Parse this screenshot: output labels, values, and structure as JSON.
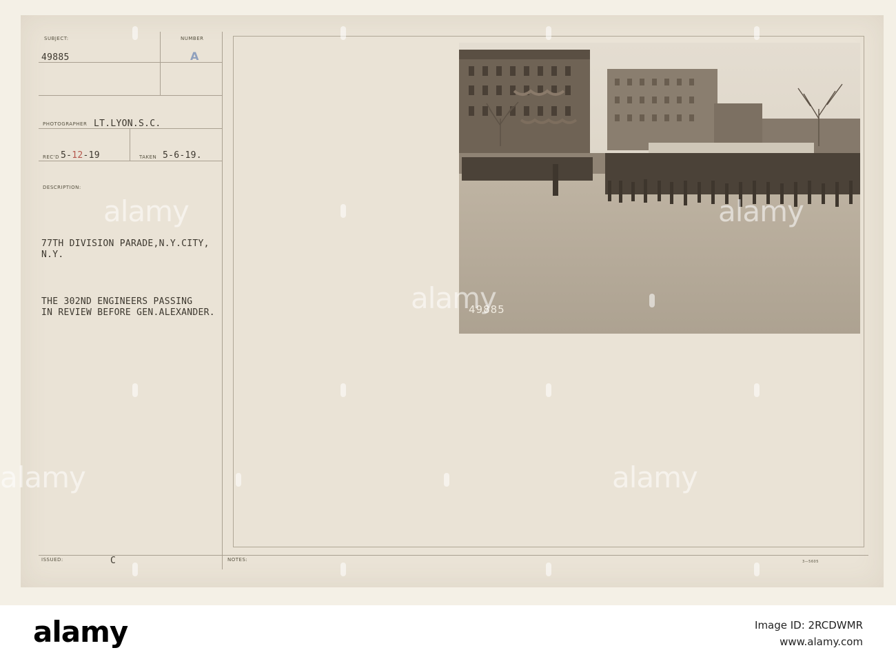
{
  "card": {
    "subject_label": "SUBJECT:",
    "subject_value": "49885",
    "number_label": "NUMBER",
    "number_value": "A",
    "photographer_label": "PHOTOGRAPHER",
    "photographer_value": "LT.LYON.S.C.",
    "recd_label": "REC'D",
    "recd_value_prefix": "5-",
    "recd_value_red": "12",
    "recd_value_suffix": "-19",
    "taken_label": "TAKEN",
    "taken_value": "5-6-19.",
    "description_label": "DESCRIPTION:",
    "description_line1": "77TH DIVISION PARADE,N.Y.CITY,",
    "description_line2": "N.Y.",
    "description_line3": "THE 302ND ENGINEERS PASSING",
    "description_line4": "IN REVIEW BEFORE GEN.ALEXANDER.",
    "issued_label": "ISSUED:",
    "issued_value": "C",
    "notes_label": "NOTES:",
    "form_code": "3—5605"
  },
  "photo": {
    "number_overlay": "49885"
  },
  "watermarks": {
    "text": "alamy"
  },
  "footer": {
    "logo": "alamy",
    "image_id_label": "Image ID: 2RCDWMR",
    "url": "www.alamy.com"
  }
}
